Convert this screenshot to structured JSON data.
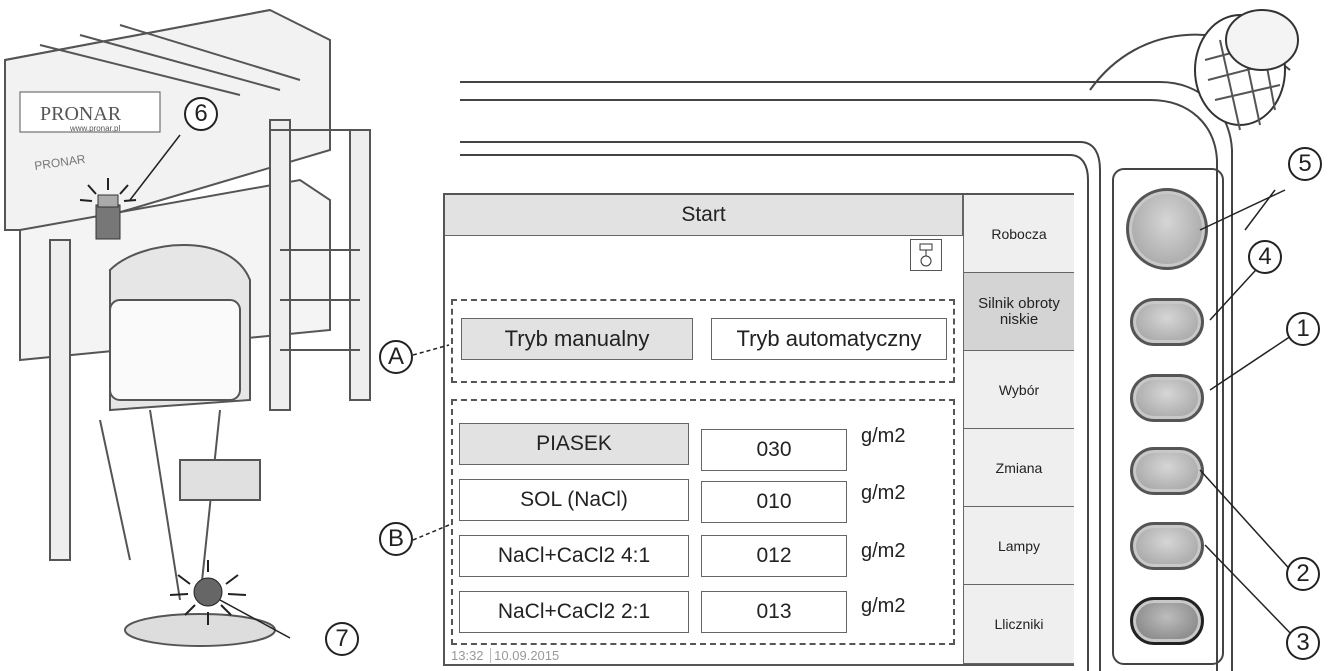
{
  "illustration": {
    "brand": "PRONAR",
    "brand_url": "www.pronar.pl",
    "model": "PRONAR"
  },
  "screen": {
    "title": "Start",
    "side_menu": [
      {
        "label": "Robocza"
      },
      {
        "label": "Silnik obroty niskie"
      },
      {
        "label": "Wybór"
      },
      {
        "label": "Zmiana"
      },
      {
        "label": "Lampy"
      },
      {
        "label": "Lliczniki"
      }
    ],
    "modes": {
      "manual": "Tryb manualny",
      "automatic": "Tryb automatyczny"
    },
    "materials": [
      {
        "name": "PIASEK",
        "rate": "030",
        "unit": "g/m2"
      },
      {
        "name": "SOL (NaCl)",
        "rate": "010",
        "unit": "g/m2"
      },
      {
        "name": "NaCl+CaCl2 4:1",
        "rate": "012",
        "unit": "g/m2"
      },
      {
        "name": "NaCl+CaCl2 2:1",
        "rate": "013",
        "unit": "g/m2"
      }
    ],
    "status": {
      "time": "13:32",
      "date": "10.09.2015"
    }
  },
  "callouts": {
    "a": "A",
    "b": "B",
    "n1": "1",
    "n2": "2",
    "n3": "3",
    "n4": "4",
    "n5": "5",
    "n6": "6",
    "n7": "7"
  },
  "icons": [
    "pump-icon",
    "warning-beacon-icon",
    "joystick-icon"
  ],
  "colors": {
    "menu_bg": "#efefef",
    "selected_bg": "#e2e2e2",
    "border": "#666666"
  }
}
